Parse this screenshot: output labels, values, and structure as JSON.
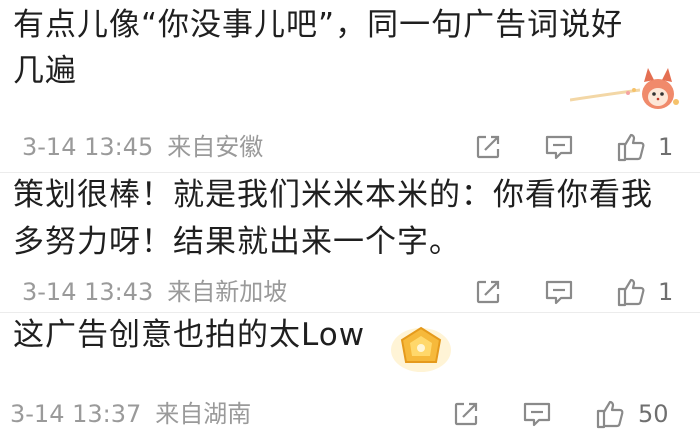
{
  "comments": [
    {
      "text_line1": "有点儿像“你没事儿吧”，同一句广告词说好",
      "text_line2": "几遍",
      "date": "3-14 13:45",
      "location": "来自安徽",
      "likes": "1"
    },
    {
      "text_line1": "策划很棒！就是我们米米本米的：你看你看我",
      "text_line2": "多努力呀！结果就出来一个字。",
      "date": "3-14 13:43",
      "location": "来自新加坡",
      "likes": "1"
    },
    {
      "text_line1": "这广告创意也拍的太Low",
      "date": "3-14 13:37",
      "location": "来自湖南",
      "likes": "50"
    }
  ],
  "icons": {
    "repost": "repost-icon",
    "comment": "comment-icon",
    "like": "thumbs-up-icon",
    "fox": "fox-sticker-icon",
    "badge": "gold-badge-icon"
  },
  "colors": {
    "text": "#1f1f1f",
    "meta": "#9a9a9a",
    "icon": "#8a8a8a",
    "badge": "#f6b93b"
  }
}
